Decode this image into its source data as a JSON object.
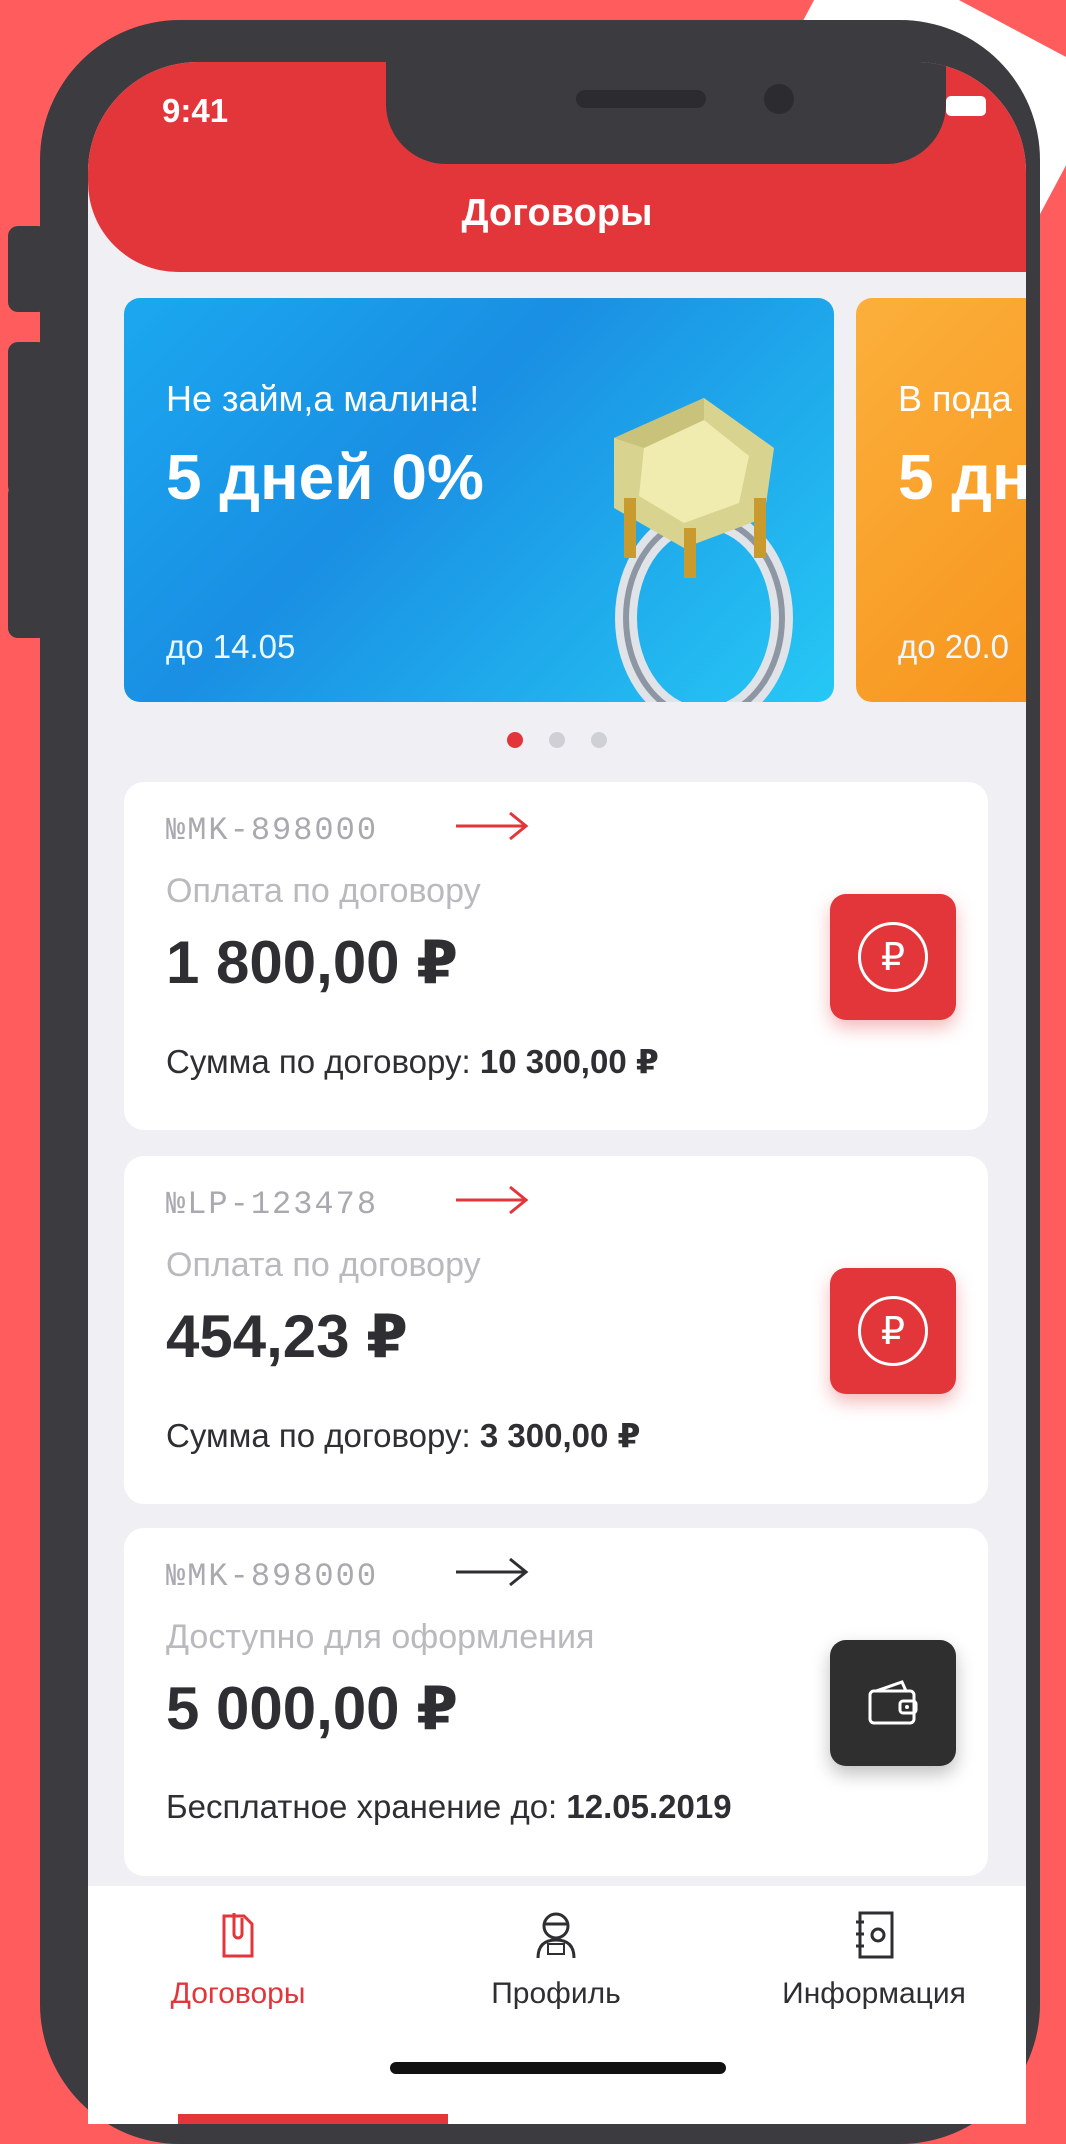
{
  "status": {
    "time": "9:41"
  },
  "header": {
    "title": "Договоры"
  },
  "banners": [
    {
      "subtitle": "Не займ,а малина!",
      "headline": "5 дней 0%",
      "date": "до 14.05",
      "color": "#1ba8f0"
    },
    {
      "subtitle": "В пода",
      "headline": "5 дн",
      "date": "до 20.0",
      "color": "#f7941d"
    }
  ],
  "pager": {
    "total": 3,
    "active": 1
  },
  "contracts": [
    {
      "number": "№MK-898000",
      "label": "Оплата по договору",
      "amount": "1 800,00 ₽",
      "footer_label": "Сумма по договору:",
      "footer_value": "10 300,00 ₽",
      "action_icon": "ruble-icon",
      "arrow_color": "#e2363b"
    },
    {
      "number": "№LP-123478",
      "label": "Оплата по договору",
      "amount": "454,23 ₽",
      "footer_label": "Сумма по договору:",
      "footer_value": "3 300,00 ₽",
      "action_icon": "ruble-icon",
      "arrow_color": "#e2363b"
    },
    {
      "number": "№MK-898000",
      "label": "Доступно для оформления",
      "amount": "5 000,00 ₽",
      "footer_label": "Бесплатное хранение до:",
      "footer_value": "12.05.2019",
      "action_icon": "wallet-icon",
      "arrow_color": "#2f2f33"
    }
  ],
  "tabbar": {
    "items": [
      {
        "label": "Договоры",
        "icon": "document-icon",
        "active": true
      },
      {
        "label": "Профиль",
        "icon": "profile-icon",
        "active": false
      },
      {
        "label": "Информация",
        "icon": "contacts-book-icon",
        "active": false
      }
    ]
  },
  "colors": {
    "accent": "#e2363b",
    "background": "#ff5d5d",
    "dark_button": "#2f2f2f"
  }
}
